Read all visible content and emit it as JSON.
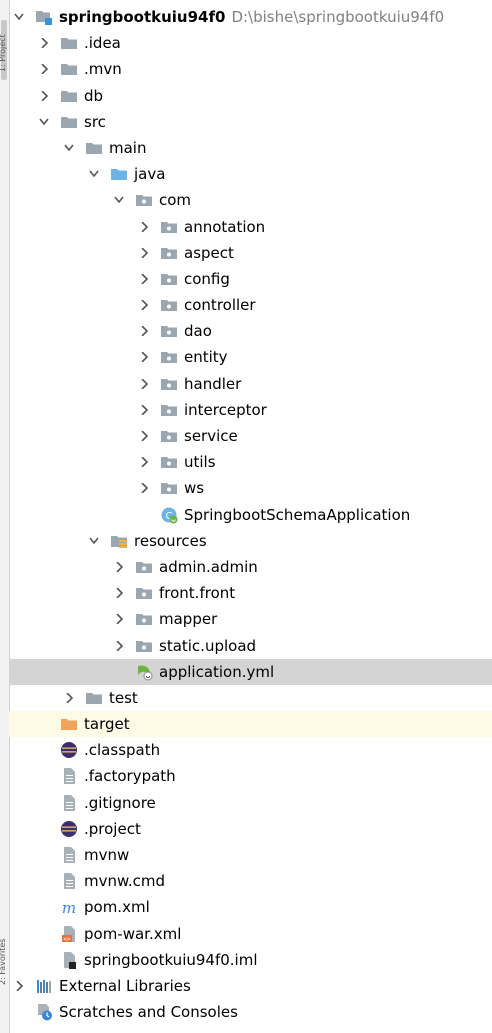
{
  "gutter": {
    "labels": [
      "1: Project",
      "2: Favorites"
    ]
  },
  "tree": {
    "root": {
      "name": "springbootkuiu94f0",
      "path": "D:\\bishe\\springbootkuiu94f0"
    },
    "items": [
      {
        "label": ".idea"
      },
      {
        "label": ".mvn"
      },
      {
        "label": "db"
      },
      {
        "label": "src"
      },
      {
        "label": "main"
      },
      {
        "label": "java"
      },
      {
        "label": "com"
      },
      {
        "label": "annotation"
      },
      {
        "label": "aspect"
      },
      {
        "label": "config"
      },
      {
        "label": "controller"
      },
      {
        "label": "dao"
      },
      {
        "label": "entity"
      },
      {
        "label": "handler"
      },
      {
        "label": "interceptor"
      },
      {
        "label": "service"
      },
      {
        "label": "utils"
      },
      {
        "label": "ws"
      },
      {
        "label": "SpringbootSchemaApplication"
      },
      {
        "label": "resources"
      },
      {
        "label": "admin.admin"
      },
      {
        "label": "front.front"
      },
      {
        "label": "mapper"
      },
      {
        "label": "static.upload"
      },
      {
        "label": "application.yml"
      },
      {
        "label": "test"
      },
      {
        "label": "target"
      },
      {
        "label": ".classpath"
      },
      {
        "label": ".factorypath"
      },
      {
        "label": ".gitignore"
      },
      {
        "label": ".project"
      },
      {
        "label": "mvnw"
      },
      {
        "label": "mvnw.cmd"
      },
      {
        "label": "pom.xml"
      },
      {
        "label": "pom-war.xml"
      },
      {
        "label": "springbootkuiu94f0.iml"
      },
      {
        "label": "External Libraries"
      },
      {
        "label": "Scratches and Consoles"
      }
    ]
  }
}
